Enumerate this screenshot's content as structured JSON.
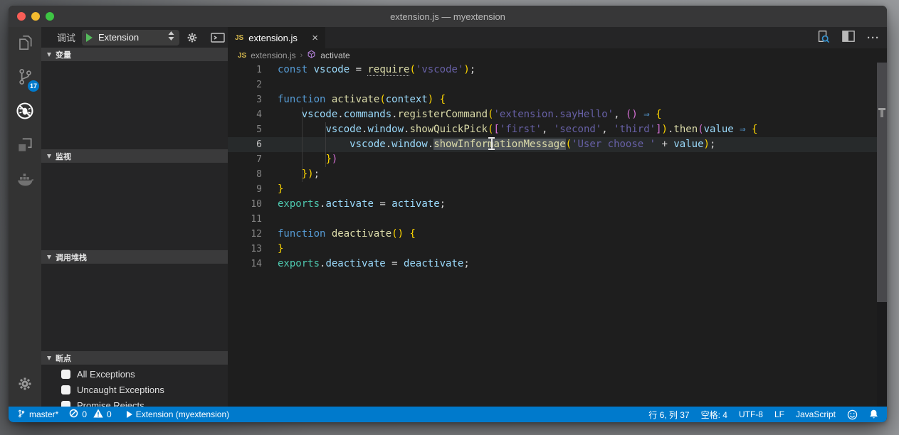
{
  "window": {
    "title": "extension.js — myextension"
  },
  "activity_bar": {
    "items": [
      "explorer",
      "source-control",
      "debug",
      "extensions",
      "docker"
    ],
    "active_item": "debug",
    "scm_badge": "17"
  },
  "sidebar": {
    "toolbar": {
      "label": "调试",
      "config_name": "Extension"
    },
    "sections": [
      {
        "title": "变量"
      },
      {
        "title": "监视"
      },
      {
        "title": "调用堆栈"
      },
      {
        "title": "断点"
      }
    ],
    "breakpoints": [
      "All Exceptions",
      "Uncaught Exceptions",
      "Promise Rejects"
    ]
  },
  "editor": {
    "tab": {
      "icon_label": "JS",
      "label": "extension.js",
      "close": "×"
    },
    "breadcrumb": {
      "file_icon": "JS",
      "file": "extension.js",
      "symbol": "activate"
    },
    "code": {
      "current_line": 6,
      "lines": [
        [
          [
            "kw",
            "const"
          ],
          [
            "pn",
            " "
          ],
          [
            "vr",
            "vscode"
          ],
          [
            "pn",
            " = "
          ],
          [
            "fn u",
            "require"
          ],
          [
            "b1",
            "("
          ],
          [
            "st",
            "'vscode'"
          ],
          [
            "b1",
            ")"
          ],
          [
            "pn",
            ";"
          ]
        ],
        [],
        [
          [
            "kw",
            "function"
          ],
          [
            "pn",
            " "
          ],
          [
            "fn",
            "activate"
          ],
          [
            "b1",
            "("
          ],
          [
            "vr",
            "context"
          ],
          [
            "b1",
            ")"
          ],
          [
            "pn",
            " "
          ],
          [
            "b1",
            "{"
          ]
        ],
        [
          [
            "pn",
            "    "
          ],
          [
            "vr",
            "vscode"
          ],
          [
            "pn",
            "."
          ],
          [
            "vr",
            "commands"
          ],
          [
            "pn",
            "."
          ],
          [
            "fn",
            "registerCommand"
          ],
          [
            "b1",
            "("
          ],
          [
            "st",
            "'extension.sayHello'"
          ],
          [
            "pn",
            ", "
          ],
          [
            "b2",
            "()"
          ],
          [
            "pn",
            " "
          ],
          [
            "ar",
            "⇒"
          ],
          [
            "pn",
            " "
          ],
          [
            "b1",
            "{"
          ]
        ],
        [
          [
            "pn",
            "        "
          ],
          [
            "vr",
            "vscode"
          ],
          [
            "pn",
            "."
          ],
          [
            "vr",
            "window"
          ],
          [
            "pn",
            "."
          ],
          [
            "fn",
            "showQuickPick"
          ],
          [
            "b1",
            "("
          ],
          [
            "b2",
            "["
          ],
          [
            "st",
            "'first'"
          ],
          [
            "pn",
            ", "
          ],
          [
            "st",
            "'second'"
          ],
          [
            "pn",
            ", "
          ],
          [
            "st",
            "'third'"
          ],
          [
            "b2",
            "]"
          ],
          [
            "b1",
            ")"
          ],
          [
            "pn",
            "."
          ],
          [
            "fn",
            "then"
          ],
          [
            "b2",
            "("
          ],
          [
            "vr",
            "value"
          ],
          [
            "pn",
            " "
          ],
          [
            "ar",
            "⇒"
          ],
          [
            "pn",
            " "
          ],
          [
            "b1",
            "{"
          ]
        ],
        [
          [
            "pn",
            "            "
          ],
          [
            "vr",
            "vscode"
          ],
          [
            "pn",
            "."
          ],
          [
            "vr",
            "window"
          ],
          [
            "pn",
            "."
          ],
          [
            "fn sel",
            "showInformationMessage"
          ],
          [
            "b1",
            "("
          ],
          [
            "st",
            "'User choose '"
          ],
          [
            "pn",
            " + "
          ],
          [
            "vr",
            "value"
          ],
          [
            "b1",
            ")"
          ],
          [
            "pn",
            ";"
          ]
        ],
        [
          [
            "pn",
            "        "
          ],
          [
            "b1",
            "}"
          ],
          [
            "b2",
            ")"
          ]
        ],
        [
          [
            "pn",
            "    "
          ],
          [
            "b1",
            "}"
          ],
          [
            "b1",
            ")"
          ],
          [
            "pn",
            ";"
          ]
        ],
        [
          [
            "b1",
            "}"
          ]
        ],
        [
          [
            "ex",
            "exports"
          ],
          [
            "pn",
            "."
          ],
          [
            "vr",
            "activate"
          ],
          [
            "pn",
            " = "
          ],
          [
            "vr",
            "activate"
          ],
          [
            "pn",
            ";"
          ]
        ],
        [],
        [
          [
            "kw",
            "function"
          ],
          [
            "pn",
            " "
          ],
          [
            "fn",
            "deactivate"
          ],
          [
            "b1",
            "()"
          ],
          [
            "pn",
            " "
          ],
          [
            "b1",
            "{"
          ]
        ],
        [
          [
            "b1",
            "}"
          ]
        ],
        [
          [
            "ex",
            "exports"
          ],
          [
            "pn",
            "."
          ],
          [
            "vr",
            "deactivate"
          ],
          [
            "pn",
            " = "
          ],
          [
            "vr",
            "deactivate"
          ],
          [
            "pn",
            ";"
          ]
        ]
      ]
    }
  },
  "status_bar": {
    "branch": "master*",
    "errors": "0",
    "warnings": "0",
    "launch": "Extension (myextension)",
    "cursor": "行 6, 列 37",
    "indent": "空格: 4",
    "encoding": "UTF-8",
    "eol": "LF",
    "language": "JavaScript"
  },
  "colors": {
    "status_bar": "#007acc",
    "editor_bg": "#1e1e1e",
    "sidebar_bg": "#252526",
    "activity_bar_bg": "#333333",
    "keyword": "#569cd6",
    "variable": "#9cdcfe",
    "function": "#dcdcaa",
    "string": "#6760a6",
    "bracket_gold": "#ffd700",
    "bracket_orchid": "#d670d6",
    "exports": "#4ec9b0",
    "badge": "#007acc",
    "js_icon": "#d7ba4d",
    "symbol_icon": "#b180d7"
  }
}
